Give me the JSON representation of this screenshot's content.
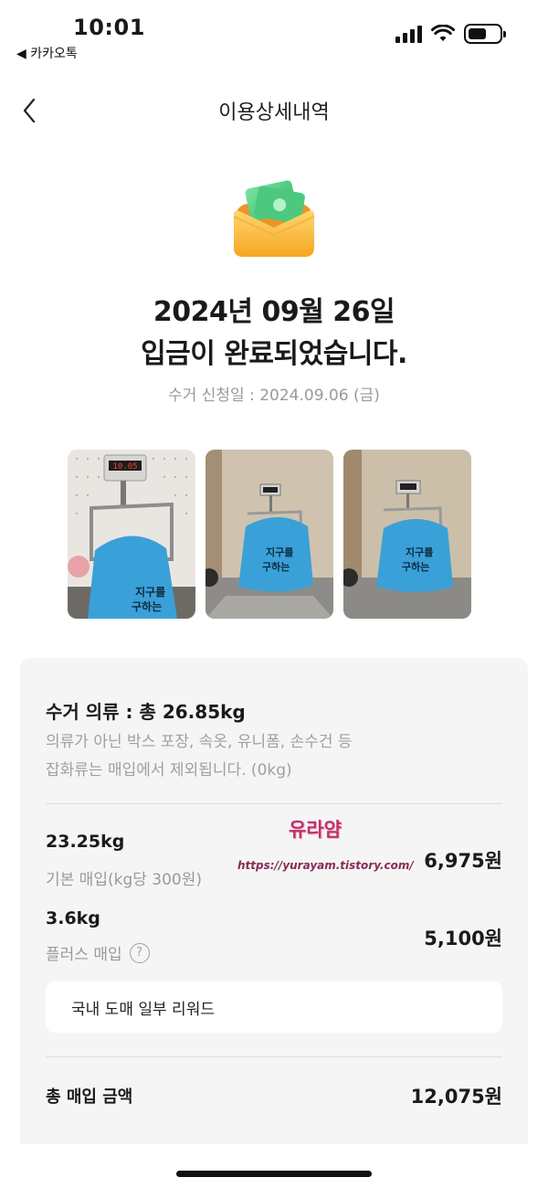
{
  "status_bar": {
    "time": "10:01",
    "back_app": "◀ 카카오톡",
    "battery_level": 0.6
  },
  "nav": {
    "title": "이용상세내역",
    "back_icon": "chevron-left-icon"
  },
  "hero": {
    "icon": "money-envelope-icon",
    "date": "2024년 09월 26일",
    "message": "입금이 완료되었습니다.",
    "request_date": "수거 신청일 : 2024.09.06 (금)"
  },
  "photos": [
    {
      "scale_display": "10.05",
      "bag_text_1": "지구를",
      "bag_text_2": "구하는"
    },
    {
      "scale_display": "",
      "bag_text_1": "지구를",
      "bag_text_2": "구하는"
    },
    {
      "scale_display": "",
      "bag_text_1": "지구를",
      "bag_text_2": "구하는"
    }
  ],
  "summary": {
    "title": "수거 의류 : 총 26.85kg",
    "desc_line1": "의류가 아닌 박스 포장, 속옷, 유니폼, 손수건 등",
    "desc_line2": "잡화류는 매입에서 제외됩니다. (0kg)",
    "basic": {
      "weight": "23.25kg",
      "label": "기본 매입(kg당 300원)",
      "amount": "6,975원"
    },
    "plus": {
      "weight": "3.6kg",
      "label": "플러스 매입",
      "help": "?",
      "amount": "5,100원"
    },
    "reward_label": "국내 도매 일부 리워드",
    "total_label": "총 매입 금액",
    "total_amount": "12,075원"
  },
  "watermark": {
    "name": "유라얌",
    "url": "https://yurayam.tistory.com/"
  },
  "colors": {
    "card_bg": "#f5f5f6",
    "muted_text": "#9a9a9a",
    "bag_blue": "#3aa0d8"
  }
}
